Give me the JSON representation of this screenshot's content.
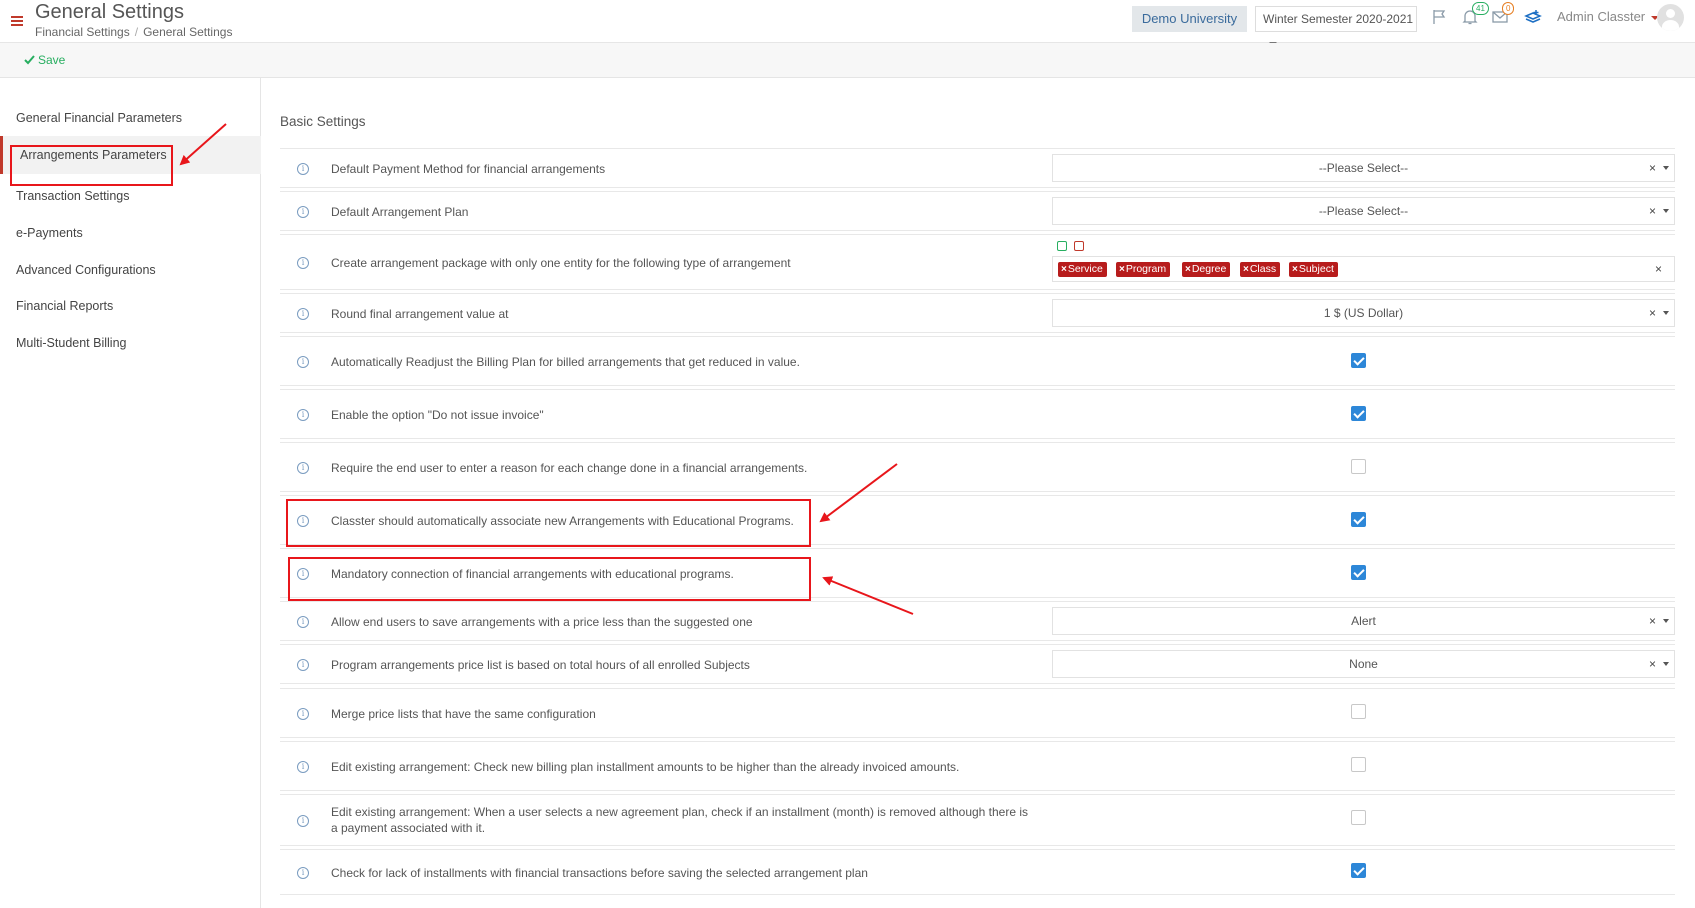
{
  "header": {
    "title": "General Settings",
    "breadcrumb": [
      "Financial Settings",
      "General Settings"
    ],
    "organization": "Demo University",
    "semester": "Winter Semester 2020-2021",
    "notifications_count": "41",
    "messages_count": "0",
    "user_name": "Admin Classter"
  },
  "toolbar": {
    "save_label": "Save"
  },
  "sidebar": {
    "items": [
      {
        "label": "General Financial Parameters"
      },
      {
        "label": "Arrangements Parameters"
      },
      {
        "label": "Transaction Settings"
      },
      {
        "label": "e-Payments"
      },
      {
        "label": "Advanced Configurations"
      },
      {
        "label": "Financial Reports"
      },
      {
        "label": "Multi-Student Billing"
      }
    ]
  },
  "main": {
    "section_title": "Basic Settings",
    "rows": [
      {
        "label": "Default Payment Method for financial arrangements",
        "control": "select",
        "value": "--Please Select--"
      },
      {
        "label": "Default Arrangement Plan",
        "control": "select",
        "value": "--Please Select--"
      },
      {
        "label": "Create arrangement package with only one entity for the following type of arrangement",
        "control": "tags",
        "tags": [
          "Service",
          "Program",
          "Degree",
          "Class",
          "Subject"
        ]
      },
      {
        "label": "Round final arrangement value at",
        "control": "select",
        "value": "1 $ (US Dollar)"
      },
      {
        "label": "Automatically Readjust the Billing Plan for billed arrangements that get reduced in value.",
        "control": "checkbox",
        "checked": true
      },
      {
        "label": "Enable the option \"Do not issue invoice\"",
        "control": "checkbox",
        "checked": true
      },
      {
        "label": "Require the end user to enter a reason for each change done in a financial arrangements.",
        "control": "checkbox",
        "checked": false
      },
      {
        "label": "Classter should automatically associate new Arrangements with Educational Programs.",
        "control": "checkbox",
        "checked": true
      },
      {
        "label": "Mandatory connection of financial arrangements with educational programs.",
        "control": "checkbox",
        "checked": true
      },
      {
        "label": "Allow end users to save arrangements with a price less than the suggested one",
        "control": "select",
        "value": "Alert"
      },
      {
        "label": "Program arrangements price list is based on total hours of all enrolled Subjects",
        "control": "select",
        "value": "None"
      },
      {
        "label": "Merge price lists that have the same configuration",
        "control": "checkbox",
        "checked": false
      },
      {
        "label": "Edit existing arrangement: Check new billing plan installment amounts to be higher than the already invoiced amounts.",
        "control": "checkbox",
        "checked": false
      },
      {
        "label": "Edit existing arrangement: When a user selects a new agreement plan, check if an installment (month) is removed although there is a payment associated with it.",
        "control": "checkbox",
        "checked": false
      },
      {
        "label": "Check for lack of installments with financial transactions before saving the selected arrangement plan",
        "control": "checkbox",
        "checked": true
      }
    ]
  },
  "colors": {
    "accent": "#c0392b",
    "checkbox_on": "#2d87d8",
    "tag": "#b71c1c",
    "annotation": "#e8161b",
    "save": "#27ae60"
  },
  "icons": [
    "hamburger-icon",
    "flag-icon",
    "bell-icon",
    "envelope-icon",
    "layers-icon",
    "check-icon",
    "info-icon"
  ]
}
